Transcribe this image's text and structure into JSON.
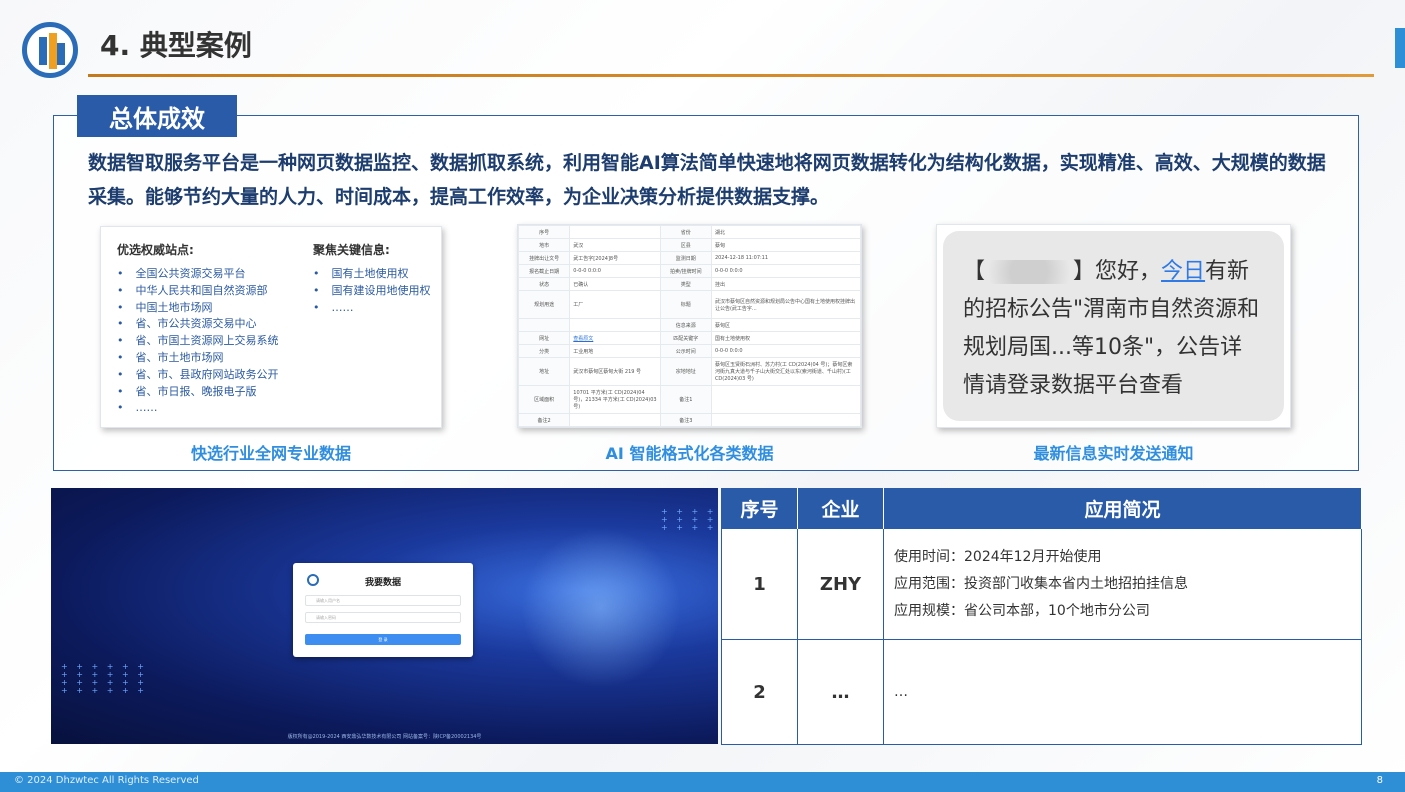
{
  "header": {
    "title": "4. 典型案例"
  },
  "summary": {
    "tag": "总体成效",
    "text": "数据智取服务平台是一种网页数据监控、数据抓取系统，利用智能AI算法简单快速地将网页数据转化为结构化数据，实现精准、高效、大规模的数据采集。能够节约大量的人力、时间成本，提高工作效率，为企业决策分析提供数据支撑。"
  },
  "card1": {
    "left_heading": "优选权威站点:",
    "left_items": [
      "全国公共资源交易平台",
      "中华人民共和国自然资源部",
      "中国土地市场网",
      "省、市公共资源交易中心",
      "省、市国土资源网上交易系统",
      "省、市土地市场网",
      "省、市、县政府网站政务公开",
      "省、市日报、晚报电子版",
      "……"
    ],
    "right_heading": "聚焦关键信息:",
    "right_items": [
      "国有土地使用权",
      "国有建设用地使用权",
      "……"
    ],
    "caption": "快选行业全网专业数据"
  },
  "card2": {
    "rows": [
      [
        "序号",
        "",
        "省份",
        "湖北"
      ],
      [
        "地市",
        "武汉",
        "区县",
        "蔡甸"
      ],
      [
        "挂牌出让文号",
        "武工告字[2024]8号",
        "监测日期",
        "2024-12-18 11:07:11"
      ],
      [
        "报名截止日期",
        "0-0-0 0:0:0",
        "拍卖/挂牌时间",
        "0-0-0 0:0:0"
      ],
      [
        "状态",
        "已确认",
        "类型",
        "挂出"
      ],
      [
        "规划用途",
        "工厂",
        "标题",
        "武汉市蔡甸区自然资源和规划局公告中心国有土地使用权挂牌出让公告(武工告字..."
      ],
      [
        "",
        "",
        "信息来源",
        "蔡甸区"
      ],
      [
        "网址",
        "查看原文",
        "匹配关键字",
        "国有土地使用权"
      ],
      [
        "分类",
        "工业用地",
        "公示时间",
        "0-0-0 0:0:0"
      ],
      [
        "地址",
        "武汉市蔡甸区蔡甸大街 219 号",
        "宗地地址",
        "蔡甸区玉贤街石洲村、苏力村(工 CD(2024)04 号)；蔡甸区索河街九真大道与千子山大街交汇处以东(索河街道、千山村)(工 CD(2024)03 号)"
      ],
      [
        "区域面积",
        "10701 平方米(工 CD(2024)04 号)，21334 平方米(工 CD(2024)03 号)",
        "备注1",
        ""
      ],
      [
        "备注2",
        "",
        "备注3",
        ""
      ]
    ],
    "caption": "AI 智能格式化各类数据"
  },
  "card3": {
    "message_prefix": "】您好，",
    "message_link": "今日",
    "message_rest": "有新的招标公告\"渭南市自然资源和规划局国...等10条\"，公告详情请登录数据平台查看",
    "bracket_open": "【",
    "caption": "最新信息实时发送通知"
  },
  "login": {
    "title": "我要数据",
    "username_placeholder": "请输入用户名",
    "password_placeholder": "请输入密码",
    "button": "登 录",
    "footer": "版权所有@2019-2024 西安鼎弘华数技术有限公司  网站备案号：陕ICP备20002134号"
  },
  "table": {
    "headers": [
      "序号",
      "企业",
      "应用简况"
    ],
    "rows": [
      {
        "no": "1",
        "company": "ZHY",
        "lines": [
          "使用时间：2024年12月开始使用",
          "应用范围：投资部门收集本省内土地招拍挂信息",
          "应用规模：省公司本部，10个地市分公司"
        ]
      },
      {
        "no": "2",
        "company": "…",
        "lines": [
          "…"
        ]
      }
    ]
  },
  "footer": {
    "copyright": "© 2024  Dhzwtec All Rights Reserved",
    "page": "8"
  },
  "colors": {
    "brand_blue": "#2a5ba8",
    "accent_light_blue": "#2f8ee0",
    "title_line_orange": "#c47a1a"
  }
}
